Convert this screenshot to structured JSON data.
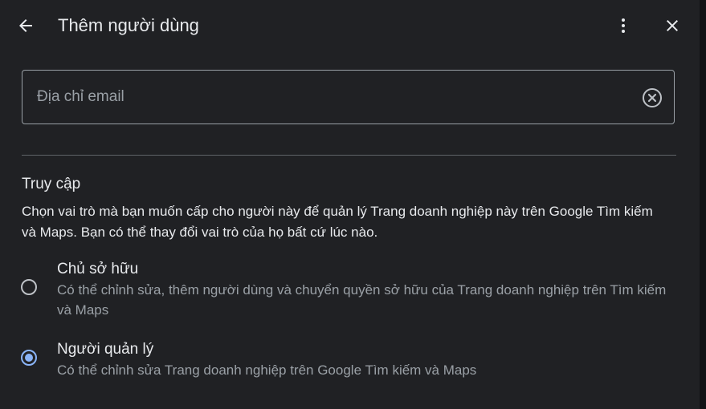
{
  "header": {
    "title": "Thêm người dùng",
    "back_icon": "arrow-back-icon",
    "more_icon": "more-vert-icon",
    "close_icon": "close-icon"
  },
  "email": {
    "placeholder": "Địa chỉ email",
    "value": "",
    "clear_icon": "clear-circle-icon"
  },
  "access": {
    "title": "Truy cập",
    "description": "Chọn vai trò mà bạn muốn cấp cho người này để quản lý Trang doanh nghiệp này trên Google Tìm kiếm và Maps. Bạn có thể thay đổi vai trò của họ bất cứ lúc nào.",
    "selected_role": "manager",
    "roles": [
      {
        "id": "owner",
        "name": "Chủ sở hữu",
        "description": "Có thể chỉnh sửa, thêm người dùng và chuyển quyền sở hữu của Trang doanh nghiệp trên Tìm kiếm và Maps"
      },
      {
        "id": "manager",
        "name": "Người quản lý",
        "description": "Có thể chỉnh sửa Trang doanh nghiệp trên Google Tìm kiếm và Maps"
      }
    ]
  },
  "colors": {
    "background": "#202124",
    "text_primary": "#e8eaed",
    "text_secondary": "#9aa0a6",
    "accent": "#8ab4f8"
  }
}
